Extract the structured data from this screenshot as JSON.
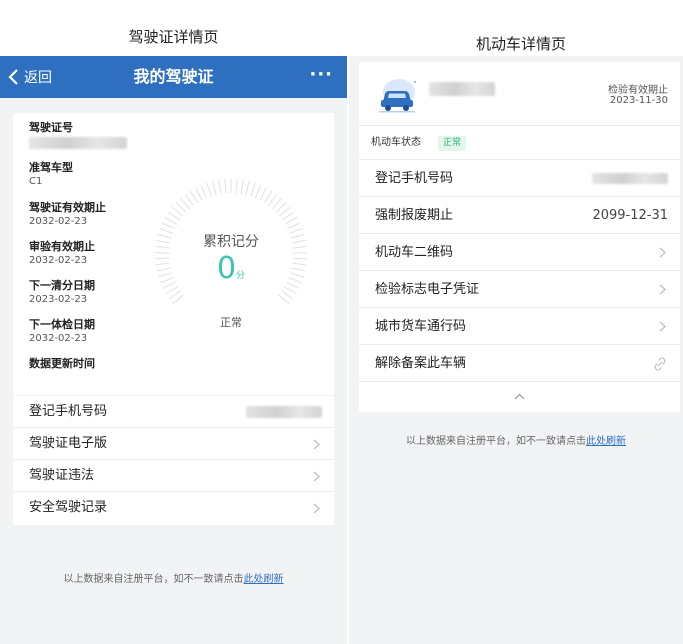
{
  "captions": {
    "left": "驾驶证详情页",
    "right": "机动车详情页"
  },
  "license_page": {
    "nav": {
      "back": "返回",
      "title": "我的驾驶证",
      "more": "···"
    },
    "fields": [
      {
        "label": "驾驶证号",
        "value": ""
      },
      {
        "label": "准驾车型",
        "value": "C1"
      },
      {
        "label": "驾驶证有效期止",
        "value": "2032-02-23"
      },
      {
        "label": "审验有效期止",
        "value": "2032-02-23"
      },
      {
        "label": "下一清分日期",
        "value": "2023-02-23"
      },
      {
        "label": "下一体检日期",
        "value": "2032-02-23"
      },
      {
        "label": "数据更新时间",
        "value": ""
      }
    ],
    "gauge": {
      "label": "累积记分",
      "score": "0",
      "unit": "分",
      "status": "正常",
      "accent": "#3ec3b0"
    },
    "rows": [
      {
        "label": "登记手机号码"
      },
      {
        "label": "驾驶证电子版"
      },
      {
        "label": "驾驶证违法"
      },
      {
        "label": "安全驾驶记录"
      }
    ],
    "footer": {
      "text": "以上数据来自注册平台，如不一致请点击",
      "link": "此处刷新"
    }
  },
  "vehicle_page": {
    "inspection": {
      "label": "检验有效期止",
      "value": "2023-11-30"
    },
    "status": {
      "label": "机动车状态",
      "badge": "正常",
      "badge_color": "#2fb27a"
    },
    "rows": [
      {
        "label": "登记手机号码",
        "value": ""
      },
      {
        "label": "强制报废期止",
        "value": "2099-12-31"
      },
      {
        "label": "机动车二维码",
        "value": ""
      },
      {
        "label": "检验标志电子凭证",
        "value": ""
      },
      {
        "label": "城市货车通行码",
        "value": ""
      },
      {
        "label": "解除备案此车辆",
        "value": ""
      }
    ],
    "icons": [
      "car-icon",
      "chevron-right-icon",
      "unlink-icon",
      "chevron-up-icon"
    ],
    "footer": {
      "text": "以上数据来自注册平台，如不一致请点击",
      "link": "此处刷新"
    }
  },
  "colors": {
    "primary": "#2f6fc0",
    "background": "#f2f3f5"
  }
}
